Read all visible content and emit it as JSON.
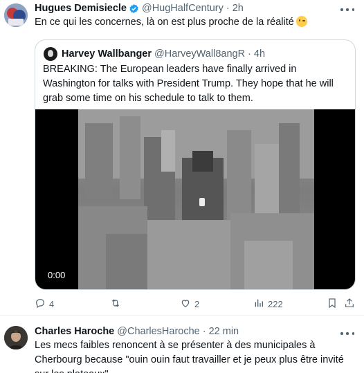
{
  "tweets": [
    {
      "display_name": "Hugues Demisiecle",
      "handle": "@HugHalfCentury",
      "separator": "·",
      "time": "2h",
      "text": "En ce qui les concernes, là on est plus proche de la réalité",
      "emoji": "winking-face",
      "quote": {
        "display_name": "Harvey Wallbanger",
        "handle": "@HarveyWall8angR",
        "separator": "·",
        "time": "4h",
        "text": "BREAKING: The European leaders have finally arrived in Washington for talks with President Trump. They hope that he will grab some time on his schedule to talk to them.",
        "video_time": "0:00"
      },
      "actions": {
        "replies": "4",
        "retweets": "",
        "likes": "2",
        "views": "222"
      }
    },
    {
      "display_name": "Charles Haroche",
      "handle": "@CharlesHaroche",
      "separator": "·",
      "time": "22 min",
      "text": "Les mecs faibles renoncent à se présenter à des municipales à Cherbourg because \"ouin ouin faut travailler et je peux plus être invité sur les plateaux\""
    }
  ],
  "colors": {
    "text_primary": "#0f1419",
    "text_secondary": "#536471",
    "verified_blue": "#1d9bf0",
    "border": "#cfd9de"
  },
  "icons": [
    "verified-badge-icon",
    "more-icon",
    "reply-icon",
    "retweet-icon",
    "like-icon",
    "views-icon",
    "bookmark-icon",
    "share-icon"
  ]
}
